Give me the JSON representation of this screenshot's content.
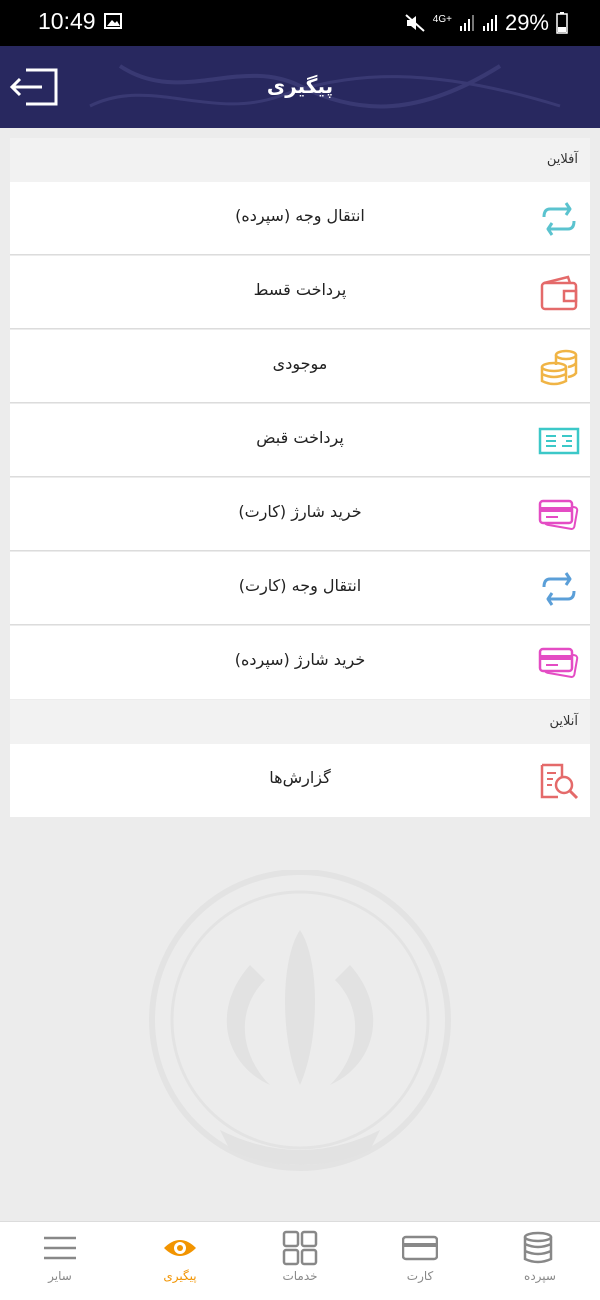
{
  "status_bar": {
    "time": "10:49",
    "network": "4G+",
    "battery": "29%"
  },
  "header": {
    "title": "پیگیری",
    "exit_icon": "exit-icon",
    "background": "#28285f"
  },
  "sections": {
    "offline": {
      "label": "آفلاین",
      "items": [
        {
          "label": "انتقال وجه (سپرده)",
          "icon": "transfer-icon"
        },
        {
          "label": "پرداخت قسط",
          "icon": "wallet-icon"
        },
        {
          "label": "موجودی",
          "icon": "coins-icon"
        },
        {
          "label": "پرداخت قبض",
          "icon": "bill-icon"
        },
        {
          "label": "خرید شارژ (کارت)",
          "icon": "charge-card-icon"
        },
        {
          "label": "انتقال وجه (کارت)",
          "icon": "transfer-icon"
        },
        {
          "label": "خرید شارژ (سپرده)",
          "icon": "charge-card-icon"
        }
      ]
    },
    "online": {
      "label": "آنلاین",
      "items": [
        {
          "label": "گزارش‌ها",
          "icon": "report-search-icon"
        }
      ]
    }
  },
  "bottom_nav": {
    "active_color": "#f29400",
    "items": [
      {
        "label": "سایر",
        "icon": "menu-icon",
        "active": false
      },
      {
        "label": "پیگیری",
        "icon": "eye-icon",
        "active": true
      },
      {
        "label": "خدمات",
        "icon": "grid-icon",
        "active": false
      },
      {
        "label": "کارت",
        "icon": "card-icon",
        "active": false
      },
      {
        "label": "سپرده",
        "icon": "coins-icon",
        "active": false
      }
    ]
  }
}
